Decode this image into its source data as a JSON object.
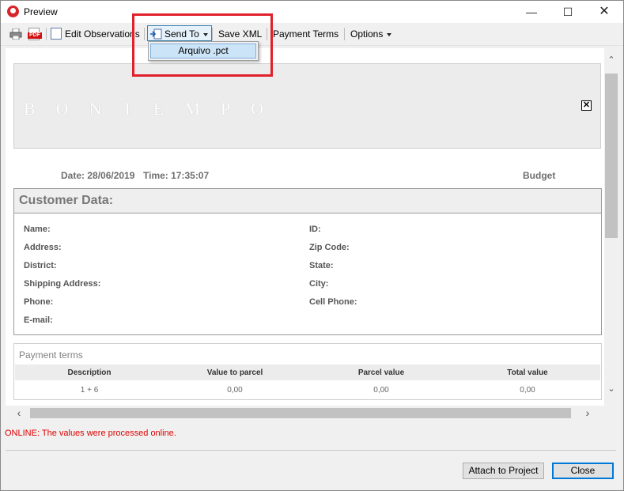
{
  "window": {
    "title": "Preview"
  },
  "toolbar": {
    "edit_observations": "Edit Observations",
    "send_to": "Send To",
    "save_xml": "Save XML",
    "payment_terms": "Payment Terms",
    "options": "Options"
  },
  "send_to_menu": {
    "items": [
      {
        "label": "Arquivo .pct"
      }
    ]
  },
  "document": {
    "banner_text": "BONTEMPO",
    "date": "Date: 28/06/2019",
    "time": "Time: 17:35:07",
    "doc_type": "Budget",
    "customer": {
      "title": "Customer Data:",
      "left_fields": [
        "Name:",
        "Address:",
        "District:",
        "Shipping Address:",
        "Phone:",
        "E-mail:"
      ],
      "right_fields": [
        "ID:",
        "Zip Code:",
        "State:",
        "City:",
        "Cell Phone:"
      ]
    },
    "payment": {
      "title": "Payment terms",
      "columns": [
        "Description",
        "Value to parcel",
        "Parcel value",
        "Total value"
      ],
      "rows": [
        [
          "1 + 6",
          "0,00",
          "0,00",
          "0,00"
        ]
      ]
    }
  },
  "status": {
    "message": "ONLINE: The values were processed online."
  },
  "buttons": {
    "attach": "Attach to Project",
    "close": "Close"
  },
  "colors": {
    "highlight": "#e0202a",
    "status_text": "#e00000",
    "accent": "#0078d7"
  }
}
